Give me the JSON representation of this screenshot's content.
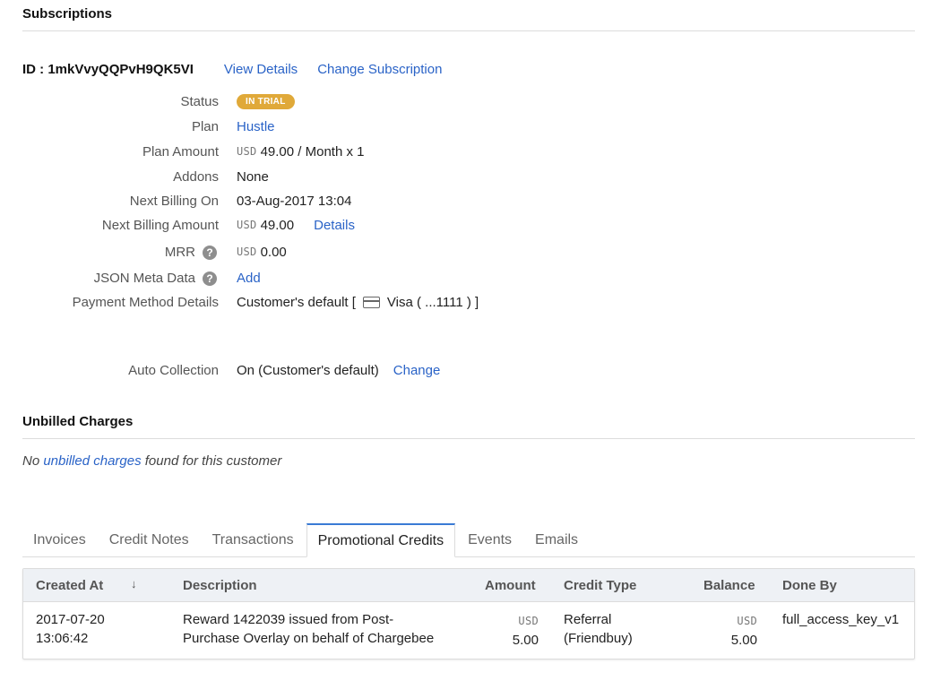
{
  "subscriptions": {
    "title": "Subscriptions",
    "id_label": "ID : 1mkVvyQQPvH9QK5VI",
    "view_details": "View Details",
    "change_subscription": "Change Subscription",
    "fields": {
      "status": {
        "label": "Status",
        "value": "IN TRIAL",
        "badge_color": "#e0a939"
      },
      "plan": {
        "label": "Plan",
        "value": "Hustle"
      },
      "plan_amount": {
        "label": "Plan Amount",
        "currency": "USD",
        "value": "49.00 / Month x 1"
      },
      "addons": {
        "label": "Addons",
        "value": "None"
      },
      "next_billing_on": {
        "label": "Next Billing On",
        "value": "03-Aug-2017 13:04"
      },
      "next_billing_amount": {
        "label": "Next Billing Amount",
        "currency": "USD",
        "value": "49.00",
        "link": "Details"
      },
      "mrr": {
        "label": "MRR",
        "help_icon": "?",
        "currency": "USD",
        "value": "0.00"
      },
      "json_meta": {
        "label": "JSON Meta Data",
        "help_icon": "?",
        "link": "Add"
      },
      "payment_method": {
        "label": "Payment Method Details",
        "prefix": "Customer's default [",
        "card": "Visa ( ...1111 ) ]"
      },
      "auto_collection": {
        "label": "Auto Collection",
        "value": "On (Customer's default)",
        "link": "Change"
      }
    }
  },
  "unbilled": {
    "title": "Unbilled Charges",
    "msg_before": "No ",
    "msg_link": "unbilled charges",
    "msg_after": " found for this customer"
  },
  "tabs": [
    "Invoices",
    "Credit Notes",
    "Transactions",
    "Promotional Credits",
    "Events",
    "Emails"
  ],
  "active_tab": "Promotional Credits",
  "table": {
    "headers": {
      "created_at": "Created At",
      "sort_icon": "↓",
      "description": "Description",
      "amount": "Amount",
      "credit_type": "Credit Type",
      "balance": "Balance",
      "done_by": "Done By"
    },
    "rows": [
      {
        "created_date": "2017-07-20",
        "created_time": "13:06:42",
        "description_line1": "Reward 1422039 issued from Post-",
        "description_line2": "Purchase Overlay on behalf of Chargebee",
        "amount_currency": "USD",
        "amount": "5.00",
        "credit_type_line1": "Referral",
        "credit_type_line2": "(Friendbuy)",
        "balance_currency": "USD",
        "balance": "5.00",
        "done_by": "full_access_key_v1"
      }
    ]
  },
  "colors": {
    "link": "#2a63c7",
    "badge": "#e0a939",
    "active_tab_border": "#3a7bd5"
  }
}
